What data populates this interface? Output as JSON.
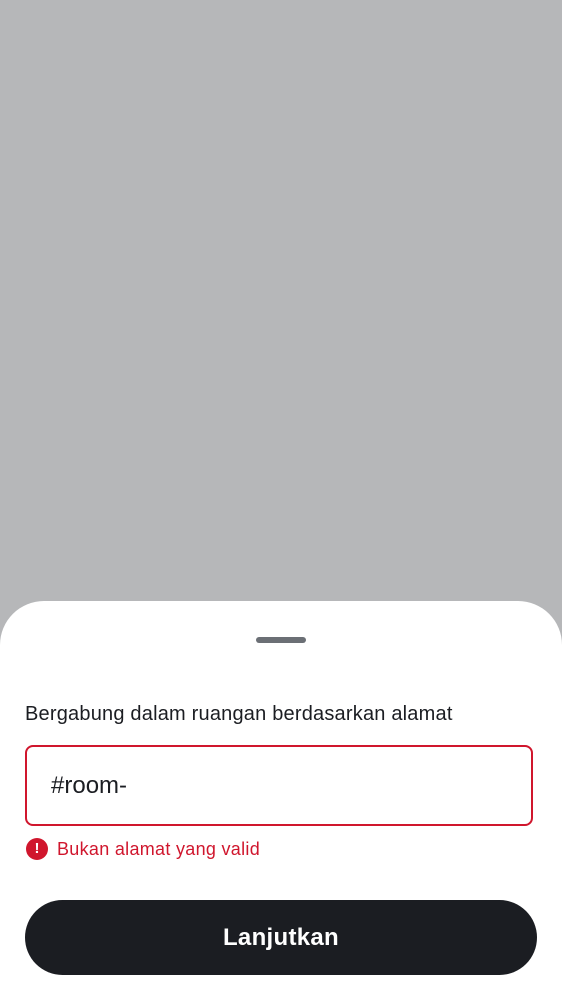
{
  "sheet": {
    "title": "Bergabung dalam ruangan berdasarkan alamat",
    "address_input": {
      "value": "#room-",
      "placeholder": ""
    },
    "error": {
      "icon": "error-icon",
      "message": "Bukan alamat yang valid"
    },
    "continue_label": "Lanjutkan"
  },
  "colors": {
    "scrim": "#b6b7b9",
    "sheet_background": "#ffffff",
    "error": "#d0162d",
    "primary_button": "#1b1d22",
    "text": "#1b1d22"
  }
}
